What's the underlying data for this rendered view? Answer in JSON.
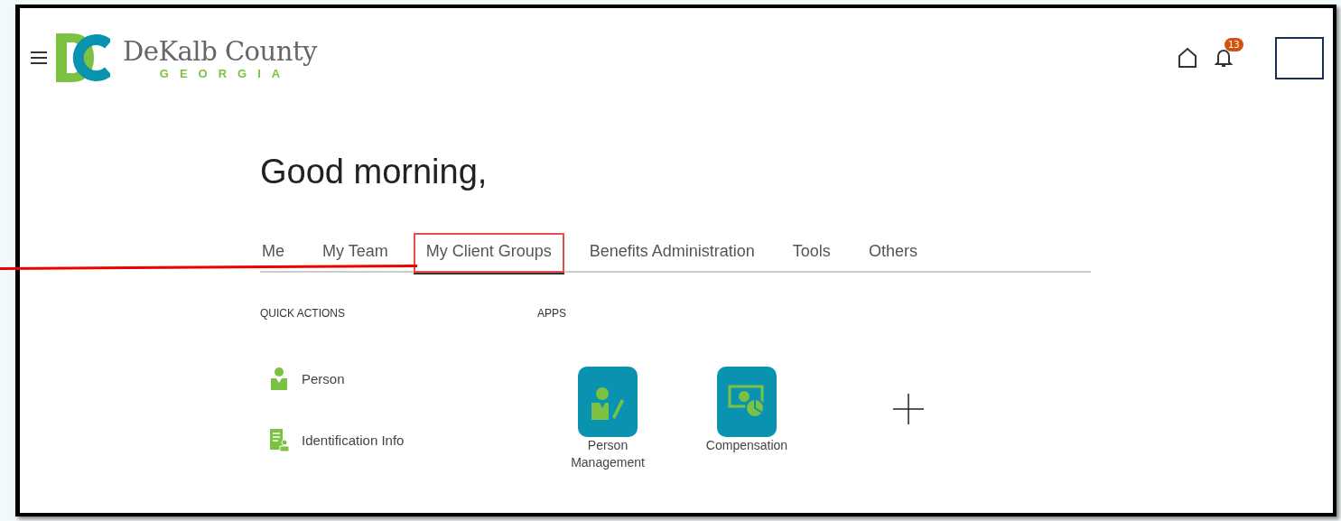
{
  "header": {
    "logo": {
      "name": "DeKalb County",
      "state": "GEORGIA"
    },
    "notifications": {
      "count": "13"
    }
  },
  "greeting": "Good morning,",
  "tabs": [
    {
      "label": "Me",
      "selected": false
    },
    {
      "label": "My Team",
      "selected": false
    },
    {
      "label": "My Client Groups",
      "selected": true
    },
    {
      "label": "Benefits Administration",
      "selected": false
    },
    {
      "label": "Tools",
      "selected": false
    },
    {
      "label": "Others",
      "selected": false
    }
  ],
  "quick_actions": {
    "title": "QUICK ACTIONS",
    "items": [
      {
        "kind": "person",
        "label": "Person"
      },
      {
        "kind": "document",
        "label": "Identification Info"
      }
    ]
  },
  "apps": {
    "title": "APPS",
    "items": [
      {
        "kind": "person",
        "label": "Person Management"
      },
      {
        "kind": "money",
        "label": "Compensation"
      }
    ]
  }
}
